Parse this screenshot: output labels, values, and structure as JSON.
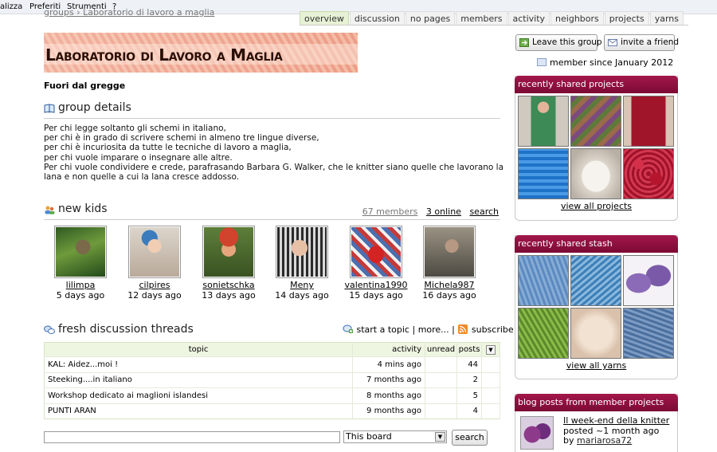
{
  "browser_menu": [
    "alizza",
    "Preferiti",
    "Strumenti",
    "?"
  ],
  "breadcrumb": "groups › Laboratorio di lavoro a maglia",
  "tabs": [
    "overview",
    "discussion",
    "no pages",
    "members",
    "activity",
    "neighbors",
    "projects",
    "yarns"
  ],
  "group": {
    "banner_title": "Laboratorio di Lavoro a Maglia",
    "subtitle": "Fuori dal gregge",
    "details_heading": "group details",
    "description": [
      "Per chi legge soltanto gli schemi in italiano,",
      "per chi è in grado di scrivere schemi in almeno tre lingue diverse,",
      "per chi è incuriosita da tutte le tecniche di lavoro a maglia,",
      "per chi vuole imparare o insegnare alle altre.",
      "Per chi vuole condividere e crede, parafrasando Barbara G. Walker, che le knitter siano quelle che lavorano la",
      "lana e non quelle a cui la lana cresce addosso."
    ]
  },
  "new_kids": {
    "heading": "new kids",
    "members_link": "67 members",
    "online_link": "3 online",
    "search_link": "search",
    "kids": [
      {
        "name": "lilimpa",
        "ago": "5 days ago"
      },
      {
        "name": "cilpires",
        "ago": "12 days ago"
      },
      {
        "name": "sonietschka",
        "ago": "13 days ago"
      },
      {
        "name": "Meny",
        "ago": "14 days ago"
      },
      {
        "name": "valentina1990",
        "ago": "15 days ago"
      },
      {
        "name": "Michela987",
        "ago": "16 days ago"
      }
    ]
  },
  "threads": {
    "heading": "fresh discussion threads",
    "start_topic": "start a topic",
    "more": "more...",
    "subscribe": "subscribe",
    "columns": {
      "topic": "topic",
      "activity": "activity",
      "unread": "unread",
      "posts": "posts"
    },
    "rows": [
      {
        "topic": "KAL: Aidez...moi !",
        "activity": "4 mins ago",
        "unread": "",
        "posts": "44"
      },
      {
        "topic": "Steeking....in italiano",
        "activity": "7 months ago",
        "unread": "",
        "posts": "2"
      },
      {
        "topic": "Workshop dedicato ai maglioni islandesi",
        "activity": "8 months ago",
        "unread": "",
        "posts": "5"
      },
      {
        "topic": "PUNTI ARAN",
        "activity": "9 months ago",
        "unread": "",
        "posts": "4"
      }
    ]
  },
  "search": {
    "input_value": "",
    "scope": "This board",
    "button": "search"
  },
  "sidebar": {
    "leave_group": "Leave this group",
    "invite_friend": "invite a friend",
    "member_since": "member since January 2012",
    "projects_heading": "recently shared projects",
    "projects_link": "view all projects",
    "stash_heading": "recently shared stash",
    "stash_link": "view all yarns",
    "blog_heading": "blog posts from member projects",
    "blog_title": "Il week-end della knitter",
    "blog_posted": "posted ~1 month ago",
    "blog_by": "by",
    "blog_author": "mariarosa72"
  }
}
